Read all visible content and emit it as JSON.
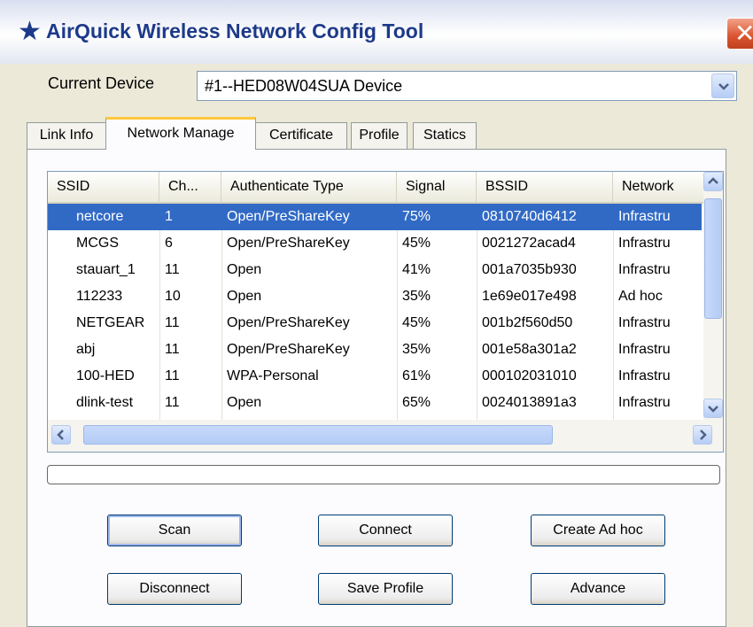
{
  "window": {
    "title": "AirQuick Wireless Network Config Tool",
    "star_icon": "star-icon",
    "close_icon": "close-icon"
  },
  "device": {
    "label": "Current Device",
    "value": "#1--HED08W04SUA Device"
  },
  "tabs": [
    {
      "label": "Link Info"
    },
    {
      "label": "Network Manage",
      "active": true
    },
    {
      "label": "Certificate"
    },
    {
      "label": "Profile"
    },
    {
      "label": "Statics"
    }
  ],
  "table": {
    "columns": [
      "SSID",
      "Ch...",
      "Authenticate Type",
      "Signal",
      "BSSID",
      "Network"
    ],
    "rows": [
      [
        "netcore",
        "1",
        "Open/PreShareKey",
        "75%",
        "0810740d6412",
        "Infrastru",
        true
      ],
      [
        "MCGS",
        "6",
        "Open/PreShareKey",
        "45%",
        "0021272acad4",
        "Infrastru",
        false
      ],
      [
        "stauart_1",
        "11",
        "Open",
        "41%",
        "001a7035b930",
        "Infrastru",
        false
      ],
      [
        "112233",
        "10",
        "Open",
        "35%",
        "1e69e017e498",
        "Ad hoc",
        false
      ],
      [
        "NETGEAR",
        "11",
        "Open/PreShareKey",
        "45%",
        "001b2f560d50",
        "Infrastru",
        false
      ],
      [
        "abj",
        "11",
        "Open/PreShareKey",
        "35%",
        "001e58a301a2",
        "Infrastru",
        false
      ],
      [
        "100-HED",
        "11",
        "WPA-Personal",
        "61%",
        "000102031010",
        "Infrastru",
        false
      ],
      [
        "dlink-test",
        "11",
        "Open",
        "65%",
        "0024013891a3",
        "Infrastru",
        false
      ]
    ]
  },
  "progress": 0,
  "buttons": {
    "scan": "Scan",
    "connect": "Connect",
    "create_adhoc": "Create Ad hoc",
    "disconnect": "Disconnect",
    "save_profile": "Save Profile",
    "advance": "Advance"
  },
  "colors": {
    "title_text": "#1d3a8a",
    "selection": "#316ac5",
    "tab_highlight": "#ffc83c",
    "window_bg": "#ece9d8"
  }
}
